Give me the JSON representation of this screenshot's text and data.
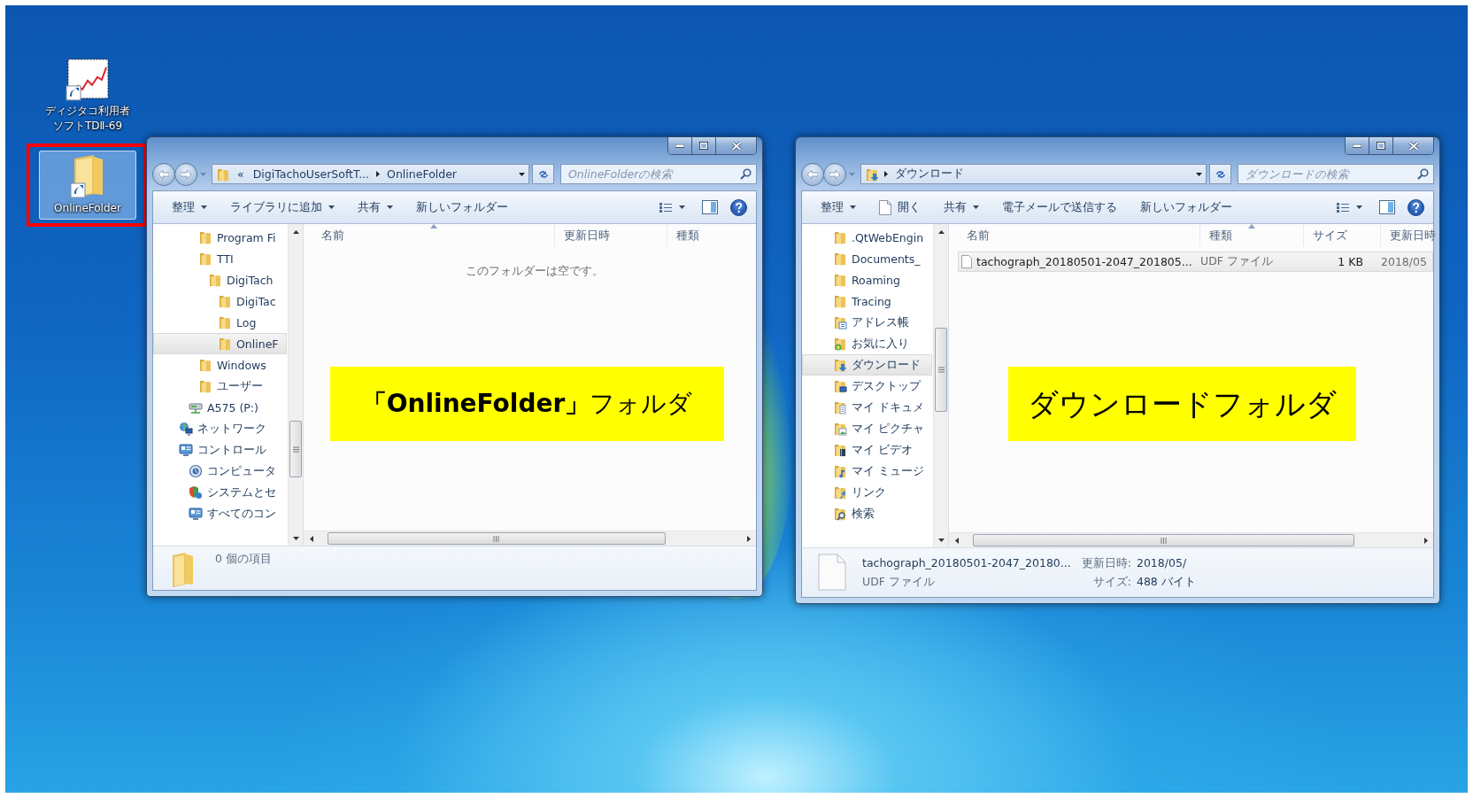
{
  "desktop": {
    "icons": [
      {
        "kind": "chart-shortcut",
        "label_lines": [
          "ディジタコ利用者",
          "ソフトTDⅡ-69"
        ],
        "selected": false,
        "annotated": false
      },
      {
        "kind": "folder-shortcut",
        "label_lines": [
          "OnlineFolder"
        ],
        "selected": true,
        "annotated": true
      }
    ]
  },
  "windows": [
    {
      "address": {
        "kind": "folder",
        "overflow": "«",
        "segments": [
          "DigiTachoUserSoftT...",
          "OnlineFolder"
        ]
      },
      "search": {
        "placeholder": "OnlineFolderの検索"
      },
      "toolbar": [
        {
          "kind": "menu",
          "label": "整理"
        },
        {
          "kind": "menu",
          "label": "ライブラリに追加"
        },
        {
          "kind": "menu",
          "label": "共有"
        },
        {
          "kind": "button",
          "label": "新しいフォルダー"
        }
      ],
      "navigation": [
        {
          "children": [
            {
              "children": [
                {
                  "label": "Program Fi",
                  "kind": "folder",
                  "selected": false
                },
                {
                  "label": "TTI",
                  "kind": "folder",
                  "selected": false,
                  "children": [
                    {
                      "label": "DigiTach",
                      "kind": "folder",
                      "selected": false,
                      "children": [
                        {
                          "label": "DigiTac",
                          "kind": "folder",
                          "selected": false
                        },
                        {
                          "label": "Log",
                          "kind": "folder",
                          "selected": false
                        },
                        {
                          "label": "OnlineF",
                          "kind": "folder",
                          "selected": true
                        }
                      ]
                    }
                  ]
                },
                {
                  "label": "Windows",
                  "kind": "folder",
                  "selected": false
                },
                {
                  "label": "ユーザー",
                  "kind": "folder",
                  "selected": false
                }
              ]
            },
            {
              "label": "A575 (P:)",
              "kind": "network-drive",
              "selected": false
            }
          ]
        },
        {
          "label": "ネットワーク",
          "kind": "network",
          "selected": false
        },
        {
          "label": "コントロール",
          "kind": "control-panel",
          "selected": false,
          "children": [
            {
              "label": "コンピュータ",
              "kind": "computer",
              "selected": false
            },
            {
              "label": "システムとセ",
              "kind": "system",
              "selected": false
            },
            {
              "label": "すべてのコン",
              "kind": "control-panel",
              "selected": false
            }
          ]
        }
      ],
      "columns": [
        {
          "label": "名前",
          "kind": "name",
          "sorted": true
        },
        {
          "label": "更新日時",
          "kind": "date",
          "sorted": false
        },
        {
          "label": "種類",
          "kind": "type",
          "sorted": false
        }
      ],
      "empty_message": "このフォルダーは空です。",
      "status": {
        "kind": "folder",
        "title": "0 個の項目"
      },
      "callout": "**「OnlineFolder」**フォルダ"
    },
    {
      "address": {
        "kind": "downloads",
        "segments": [
          "ダウンロード"
        ]
      },
      "search": {
        "placeholder": "ダウンロードの検索"
      },
      "toolbar": [
        {
          "kind": "menu",
          "label": "整理"
        },
        {
          "kind": "open",
          "label": "開く"
        },
        {
          "kind": "menu",
          "label": "共有"
        },
        {
          "kind": "button",
          "label": "電子メールで送信する"
        },
        {
          "kind": "button",
          "label": "新しいフォルダー"
        }
      ],
      "navigation": [
        {
          "label": ".QtWebEngin",
          "kind": "folder",
          "selected": false
        },
        {
          "label": "Documents_",
          "kind": "folder",
          "selected": false
        },
        {
          "label": "Roaming",
          "kind": "folder",
          "selected": false
        },
        {
          "label": "Tracing",
          "kind": "folder",
          "selected": false
        },
        {
          "label": "アドレス帳",
          "kind": "contacts",
          "selected": false
        },
        {
          "label": "お気に入り",
          "kind": "favorites",
          "selected": false
        },
        {
          "label": "ダウンロード",
          "kind": "downloads",
          "selected": true
        },
        {
          "label": "デスクトップ",
          "kind": "desktop",
          "selected": false
        },
        {
          "label": "マイ ドキュメ",
          "kind": "documents",
          "selected": false
        },
        {
          "label": "マイ ピクチャ",
          "kind": "pictures",
          "selected": false
        },
        {
          "label": "マイ ビデオ",
          "kind": "videos",
          "selected": false
        },
        {
          "label": "マイ ミュージ",
          "kind": "music",
          "selected": false
        },
        {
          "label": "リンク",
          "kind": "links",
          "selected": false
        },
        {
          "label": "検索",
          "kind": "search",
          "selected": false
        }
      ],
      "columns": [
        {
          "label": "名前",
          "kind": "name",
          "sorted": false
        },
        {
          "label": "種類",
          "kind": "type",
          "sorted": true
        },
        {
          "label": "サイズ",
          "kind": "size",
          "sorted": false
        },
        {
          "label": "更新日時",
          "kind": "date",
          "sorted": false
        }
      ],
      "rows": [
        {
          "cells": [
            "tachograph_20180501-2047_201805...",
            "UDF ファイル",
            "1 KB",
            "2018/05"
          ],
          "selected": true
        }
      ],
      "status": {
        "kind": "file",
        "title": "tachograph_20180501-2047_20180...",
        "subtitle": "UDF ファイル",
        "details": [
          {
            "label": "更新日時:",
            "value": "2018/05/"
          },
          {
            "label": "サイズ:",
            "value": "488 バイト"
          }
        ]
      },
      "callout": "ダウンロードフォルダ"
    }
  ]
}
